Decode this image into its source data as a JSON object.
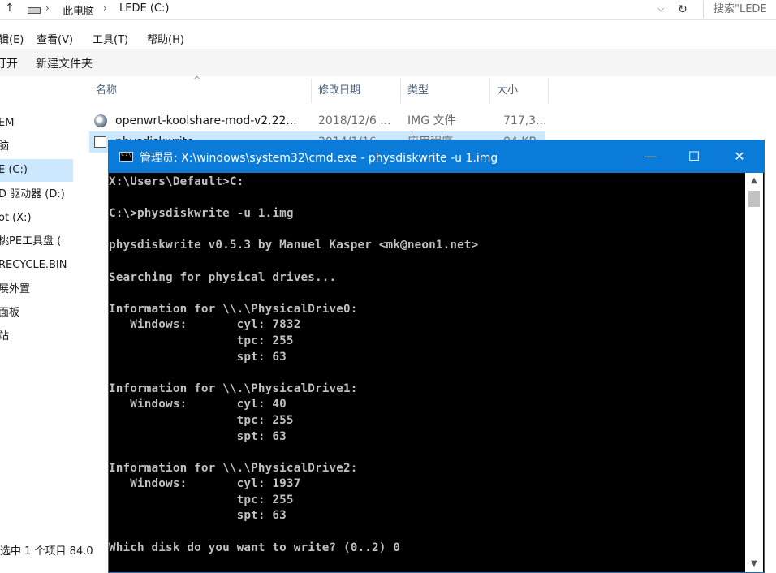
{
  "explorer": {
    "breadcrumb": [
      "此电脑",
      "LEDE (C:)"
    ],
    "search_placeholder": "搜索\"LEDE",
    "menus": [
      "辑(E)",
      "查看(V)",
      "工具(T)",
      "帮助(H)"
    ],
    "commands": [
      "打开",
      "新建文件夹"
    ],
    "columns": [
      "名称",
      "修改日期",
      "类型",
      "大小"
    ],
    "nav_items": [
      "EM",
      "脑",
      "E (C:)",
      "D 驱动器 (D:)",
      "ot (X:)",
      "桃PE工具盘 (",
      "RECYCLE.BIN",
      "展外置",
      "面板",
      "站"
    ],
    "selected_nav_index": 2,
    "files": [
      {
        "name": "openwrt-koolshare-mod-v2.22...",
        "date": "2018/12/6 ...",
        "type": "IMG 文件",
        "size": "717,3...",
        "icon": "disc-image-icon"
      },
      {
        "name": "physdiskwrite",
        "date": "2014/1/16 ...",
        "type": "应用程序",
        "size": "84 KB",
        "icon": "executable-icon"
      }
    ],
    "status": "选中 1 个项目  84.0"
  },
  "cmd": {
    "title": "管理员: X:\\windows\\system32\\cmd.exe - physdiskwrite  -u 1.img",
    "icon_label": "C:\\",
    "buttons": {
      "minimize": "—",
      "maximize": "☐",
      "close": "✕"
    },
    "lines": [
      "X:\\Users\\Default>C:",
      "",
      "C:\\>physdiskwrite -u 1.img",
      "",
      "physdiskwrite v0.5.3 by Manuel Kasper <mk@neon1.net>",
      "",
      "Searching for physical drives...",
      "",
      "Information for \\\\.\\PhysicalDrive0:",
      "   Windows:       cyl: 7832",
      "                  tpc: 255",
      "                  spt: 63",
      "",
      "Information for \\\\.\\PhysicalDrive1:",
      "   Windows:       cyl: 40",
      "                  tpc: 255",
      "                  spt: 63",
      "",
      "Information for \\\\.\\PhysicalDrive2:",
      "   Windows:       cyl: 1937",
      "                  tpc: 255",
      "                  spt: 63",
      "",
      "Which disk do you want to write? (0..2) 0"
    ]
  }
}
